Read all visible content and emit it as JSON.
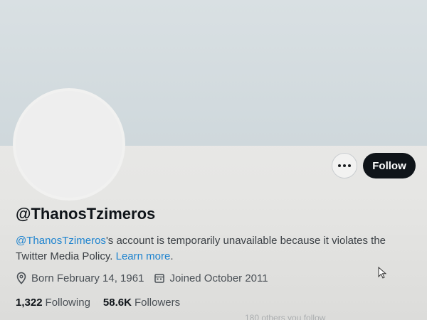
{
  "profile": {
    "more_button_icon": "more-horizontal-icon",
    "follow_label": "Follow",
    "handle": "@ThanosTzimeros",
    "notice": {
      "link_handle": "@ThanosTzimeros",
      "text": "'s account is temporarily unavailable because it violates the Twitter Media Policy. ",
      "learn_more": "Learn more",
      "end": "."
    },
    "meta": {
      "birth_icon": "location-pin-icon",
      "born": "Born February 14, 1961",
      "joined_icon": "calendar-icon",
      "joined": "Joined October 2011"
    },
    "stats": {
      "following_count": "1,322",
      "following_label": "Following",
      "followers_count": "58.6K",
      "followers_label": "Followers"
    },
    "faded_text": "180 others you follow"
  },
  "colors": {
    "accent": "#1d83cf",
    "follow_bg": "#0f1419",
    "banner": "#d3dbdf"
  }
}
